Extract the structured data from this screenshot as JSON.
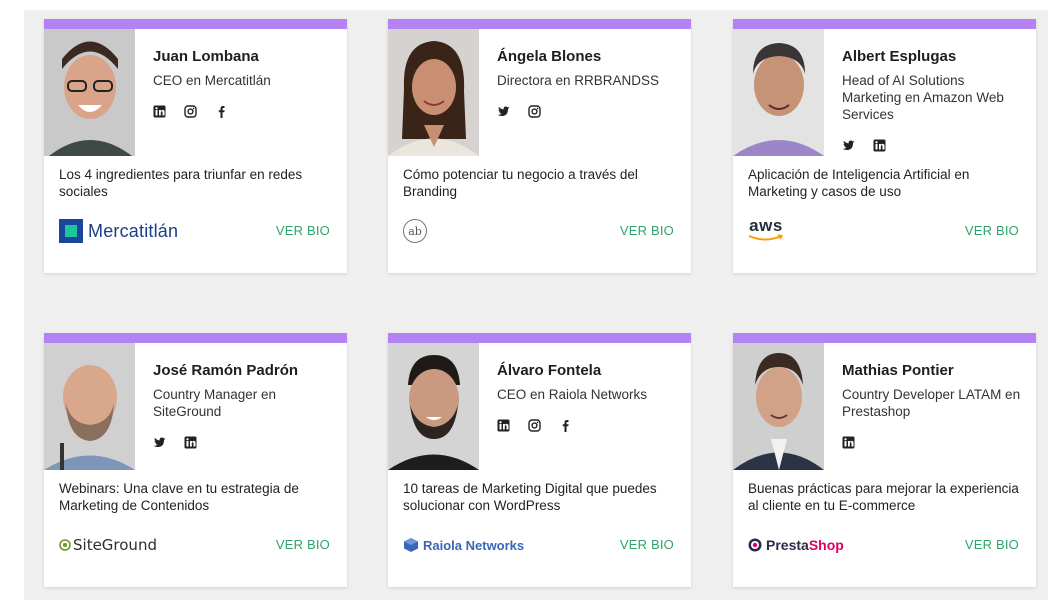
{
  "speakers": [
    {
      "name": "Juan Lombana",
      "role": "CEO en Mercatitlán",
      "talk": "Los 4 ingredientes para triunfar en redes sociales",
      "logo_text": "Mercatitlán",
      "cta": "VER BIO",
      "socials": [
        "linkedin-icon",
        "instagram-icon",
        "facebook-icon"
      ]
    },
    {
      "name": "Ángela Blones",
      "role": "Directora en RRBRANDSS",
      "talk": "Cómo potenciar tu negocio a través del Branding",
      "logo_text": "ab",
      "cta": "VER BIO",
      "socials": [
        "twitter-icon",
        "instagram-icon"
      ]
    },
    {
      "name": "Albert Esplugas",
      "role": "Head of AI Solutions Marketing en Amazon Web Services",
      "talk": "Aplicación de Inteligencia Artificial en Marketing y casos de uso",
      "logo_text": "aws",
      "cta": "VER BIO",
      "socials": [
        "twitter-icon",
        "linkedin-icon"
      ]
    },
    {
      "name": "José Ramón Padrón",
      "role": "Country Manager en SiteGround",
      "talk": "Webinars: Una clave en tu estrategia de Marketing de Contenidos",
      "logo_text": "SiteGround",
      "cta": "VER BIO",
      "socials": [
        "twitter-icon",
        "linkedin-icon"
      ]
    },
    {
      "name": "Álvaro Fontela",
      "role": "CEO en Raiola Networks",
      "talk": "10 tareas de Marketing Digital que puedes solucionar con WordPress",
      "logo_text": "Raiola Networks",
      "cta": "VER BIO",
      "socials": [
        "linkedin-icon",
        "instagram-icon",
        "facebook-icon"
      ]
    },
    {
      "name": "Mathias Pontier",
      "role": "Country Developer LATAM en Prestashop",
      "talk": "Buenas prácticas para mejorar la experiencia al cliente en tu E-commerce",
      "logo_text_1": "Presta",
      "logo_text_2": "Shop",
      "cta": "VER BIO",
      "socials": [
        "linkedin-icon"
      ]
    }
  ],
  "colors": {
    "accent_bar": "#b383f4",
    "cta": "#2ea46b",
    "background": "#efefef"
  }
}
